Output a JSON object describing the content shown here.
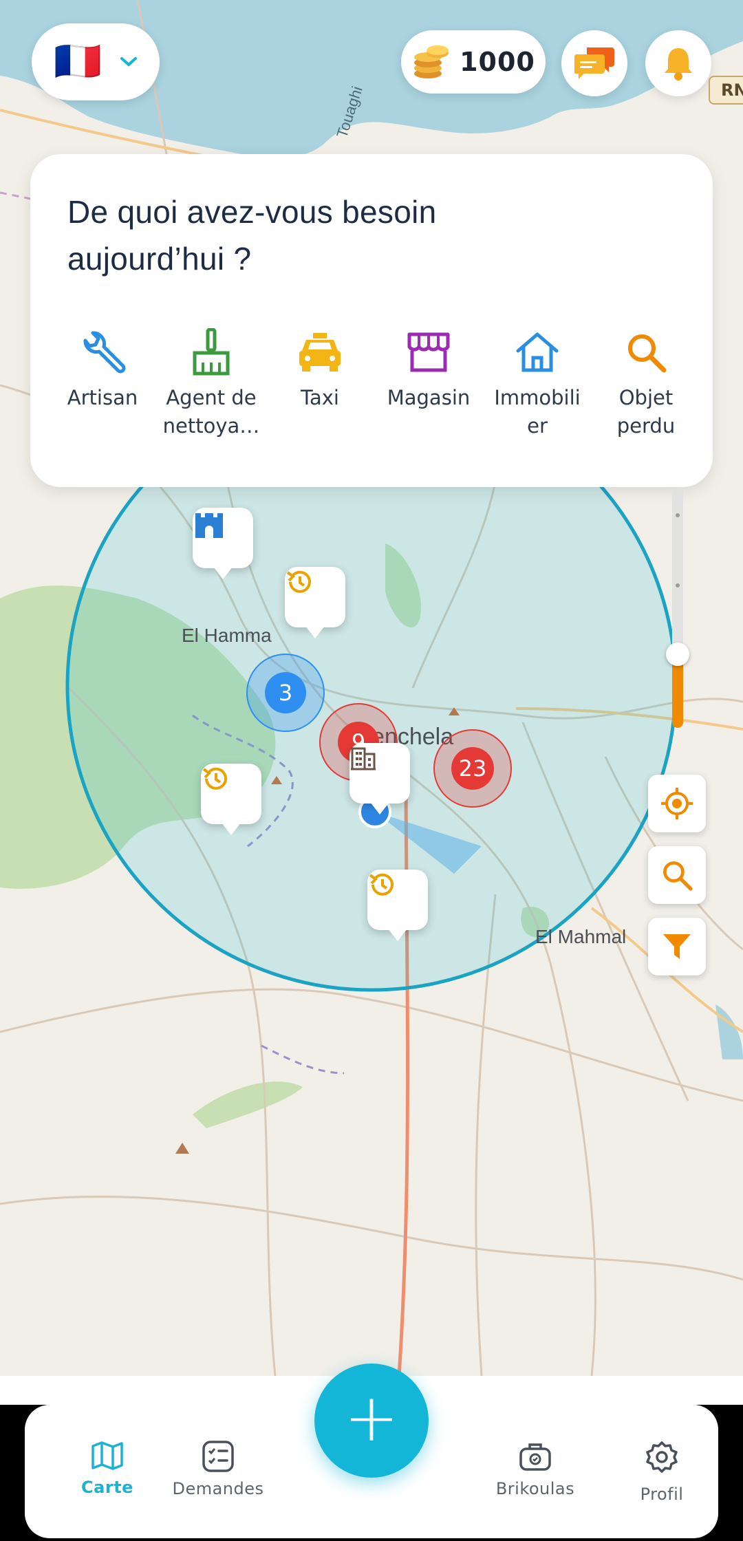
{
  "header": {
    "language_flag": "🇫🇷",
    "coins_value": "1000",
    "road_badge": "RN"
  },
  "card": {
    "title": "De quoi avez-vous besoin aujourd’hui ?",
    "categories": [
      {
        "label": "Artisan",
        "icon": "wrench-icon",
        "color": "#2a8fe0"
      },
      {
        "label": "Agent de\nnettoya…",
        "icon": "broom-icon",
        "color": "#3a9a3e"
      },
      {
        "label": "Taxi",
        "icon": "taxi-icon",
        "color": "#f3b514"
      },
      {
        "label": "Magasin",
        "icon": "store-icon",
        "color": "#9b2bb0"
      },
      {
        "label": "Immobili\ner",
        "icon": "house-icon",
        "color": "#2a8fe0"
      },
      {
        "label": "Objet\nperdu",
        "icon": "search-icon",
        "color": "#f08a00"
      }
    ]
  },
  "map": {
    "places": [
      "El Hamma",
      "enchela",
      "El Mahmal",
      "Touaghi"
    ],
    "clusters": [
      {
        "count": "3",
        "color": "#2f8ff0"
      },
      {
        "count": "9",
        "color": "#e53935"
      },
      {
        "count": "23",
        "color": "#e53935"
      }
    ],
    "accent_color": "#13b6d6",
    "radius_color": "#1aa3c2"
  },
  "nav": {
    "items": [
      {
        "label": "Carte",
        "active": true
      },
      {
        "label": "Demandes",
        "active": false
      },
      {
        "label": "Brikoulas",
        "active": false
      },
      {
        "label": "Profil",
        "active": false
      }
    ],
    "fab_label": "+"
  }
}
